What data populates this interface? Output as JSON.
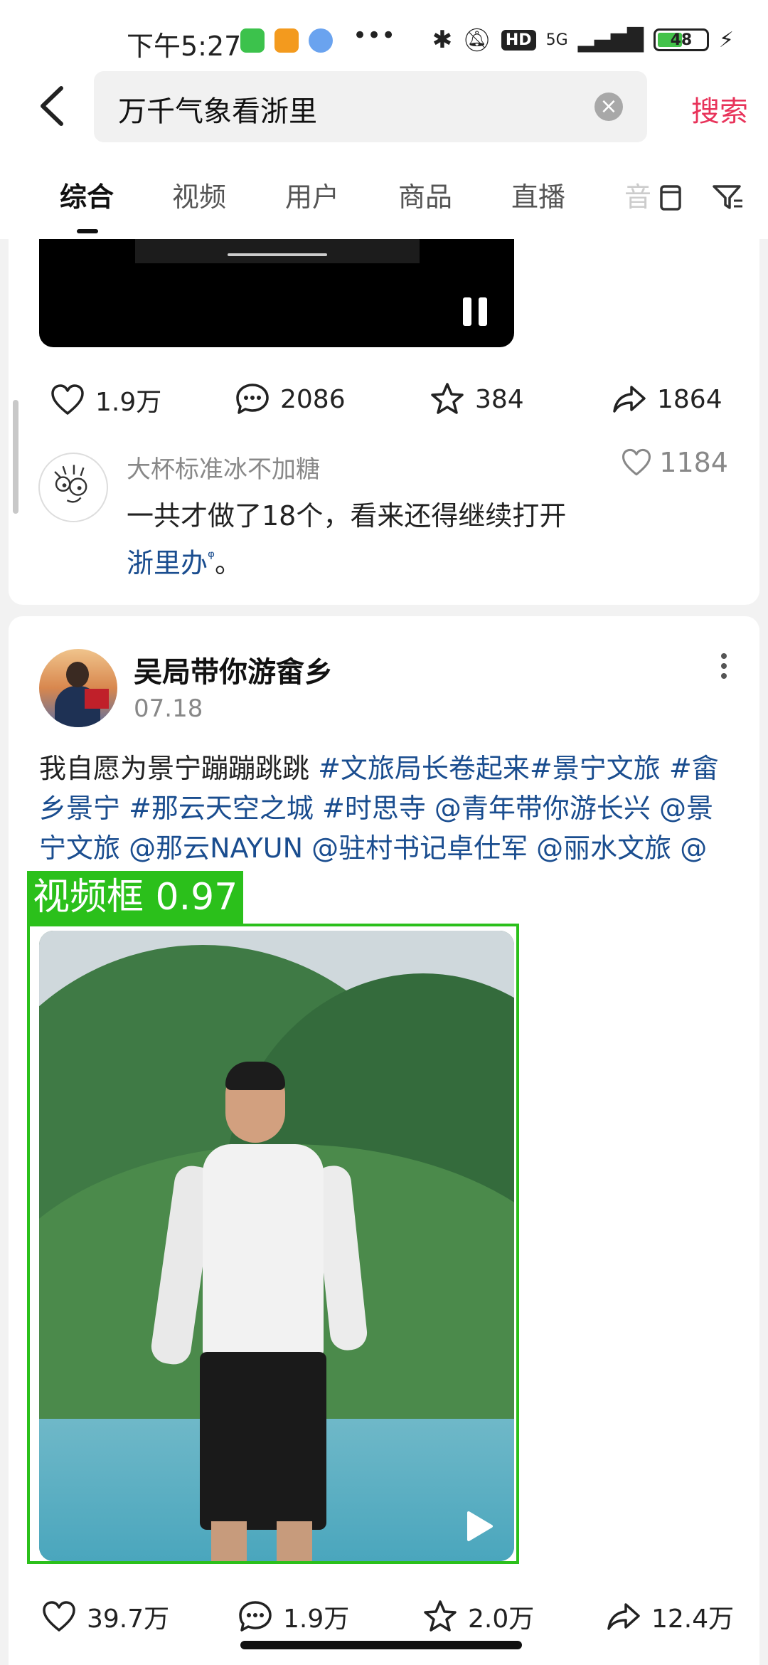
{
  "status_bar": {
    "time": "下午5:27",
    "network": "5G",
    "battery": "48"
  },
  "search": {
    "query": "万千气象看浙里",
    "submit_label": "搜索"
  },
  "tabs": [
    {
      "label": "综合",
      "active": true
    },
    {
      "label": "视频"
    },
    {
      "label": "用户"
    },
    {
      "label": "商品"
    },
    {
      "label": "直播"
    },
    {
      "label": "音"
    }
  ],
  "post1": {
    "likes": "1.9万",
    "comments": "2086",
    "favorites": "384",
    "shares": "1864",
    "top_comment": {
      "user": "大杯标准冰不加糖",
      "likes": "1184",
      "text": "一共才做了18个，看来还得继续打开",
      "link": "浙里办",
      "suffix": "。"
    }
  },
  "post2": {
    "author": "吴局带你游畲乡",
    "date": "07.18",
    "text_plain": "我自愿为景宁蹦蹦跳跳 ",
    "text_links": "#文旅局长卷起来#景宁文旅 #畲乡景宁 #那云天空之城 #时思寺 @青年带你游长兴 @景宁文旅 @那云NAYUN @驻村书记卓仕军 @丽水文旅 @三农之家",
    "likes": "39.7万",
    "comments": "1.9万",
    "favorites": "2.0万",
    "shares": "12.4万"
  },
  "detection": {
    "label": "视频框 0.97",
    "color": "#2bc01b"
  },
  "colors": {
    "accent": "#e8335a",
    "link": "#1a4d8f"
  }
}
